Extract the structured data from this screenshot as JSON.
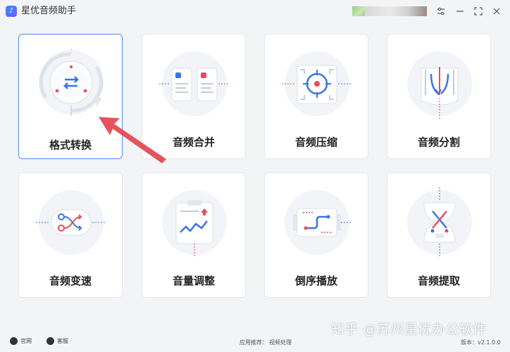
{
  "app": {
    "title": "星优音频助手",
    "logo_glyph": "♪"
  },
  "window": {
    "settings_glyph": "⚙",
    "minimize_glyph": "—",
    "maximize_glyph": "⛶",
    "close_glyph": "✕"
  },
  "cards": [
    {
      "id": "format-convert",
      "label": "格式转换",
      "icon": "convert-icon",
      "active": true
    },
    {
      "id": "audio-merge",
      "label": "音频合并",
      "icon": "merge-icon",
      "active": false
    },
    {
      "id": "audio-compress",
      "label": "音频压缩",
      "icon": "compress-icon",
      "active": false
    },
    {
      "id": "audio-split",
      "label": "音频分割",
      "icon": "split-icon",
      "active": false
    },
    {
      "id": "audio-speed",
      "label": "音频变速",
      "icon": "speed-icon",
      "active": false
    },
    {
      "id": "volume-adjust",
      "label": "音量调整",
      "icon": "volume-icon",
      "active": false
    },
    {
      "id": "reverse-play",
      "label": "倒序播放",
      "icon": "reverse-icon",
      "active": false
    },
    {
      "id": "audio-extract",
      "label": "音频提取",
      "icon": "extract-icon",
      "active": false
    }
  ],
  "footer": {
    "website": "官网",
    "support": "客服",
    "recommend_label": "应用推荐：",
    "recommend_app": "视频处理",
    "version": "版本：v2.1.0.0"
  },
  "watermark": "知乎 @苏州星优办公软件",
  "colors": {
    "accent": "#4d8dff",
    "red": "#e94b5a",
    "arrow": "#e5535f"
  }
}
